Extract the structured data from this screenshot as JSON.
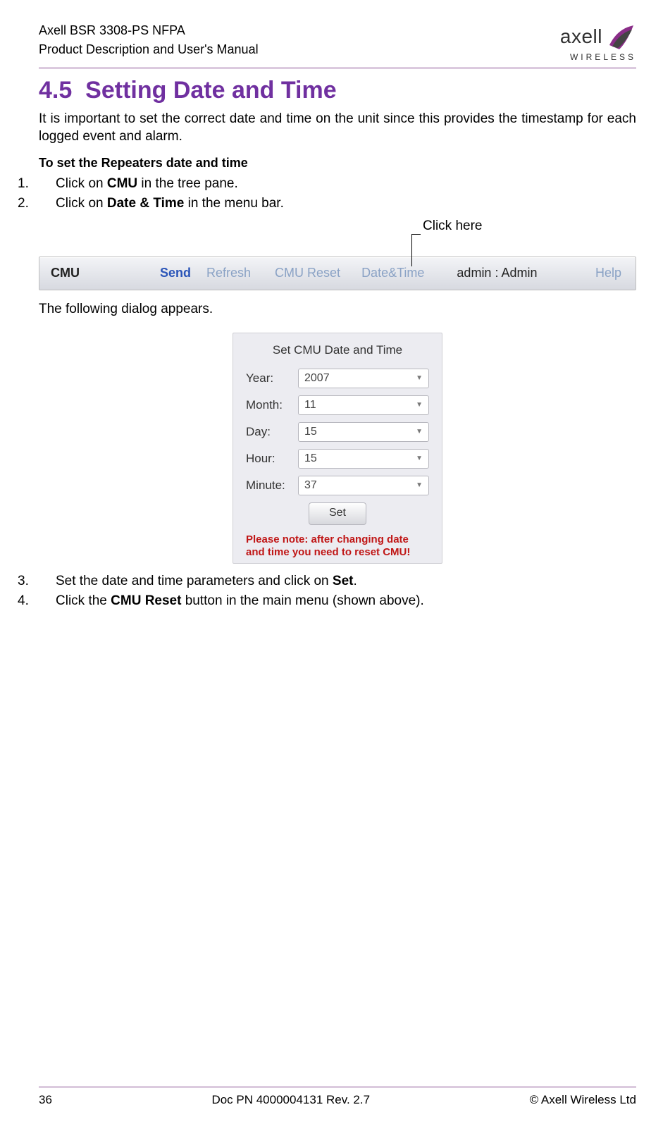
{
  "header": {
    "line1": "Axell BSR 3308-PS NFPA",
    "line2": "Product Description and User's Manual",
    "brand": "axell",
    "brand_sub": "WIRELESS"
  },
  "section": {
    "number": "4.5",
    "title": "Setting Date and Time"
  },
  "intro": "It is important to set the correct date and time on the unit since this provides the timestamp for each logged event and alarm.",
  "subhead": "To set the Repeaters date and time",
  "step1_pre": "Click on ",
  "step1_bold": "CMU",
  "step1_post": " in the tree pane.",
  "step2_pre": "Click on ",
  "step2_bold": "Date & Time",
  "step2_post": " in the menu bar.",
  "callout": "Click here",
  "menubar": {
    "cmu": "CMU",
    "send": "Send",
    "refresh": "Refresh",
    "reset": "CMU Reset",
    "datetime": "Date&Time",
    "admin": "admin : Admin",
    "help": "Help"
  },
  "following": "The following dialog appears.",
  "dialog": {
    "title": "Set CMU Date and Time",
    "rows": [
      {
        "label": "Year:",
        "value": "2007"
      },
      {
        "label": "Month:",
        "value": "11"
      },
      {
        "label": "Day:",
        "value": "15"
      },
      {
        "label": "Hour:",
        "value": "15"
      },
      {
        "label": "Minute:",
        "value": "37"
      }
    ],
    "set": "Set",
    "warn": "Please note: after changing date and time you need to reset CMU!"
  },
  "step3_pre": "Set the date and time parameters and click on ",
  "step3_bold": "Set",
  "step4_pre": "Click the ",
  "step4_bold": "CMU Reset",
  "step4_post": " button in the main menu (shown above).",
  "footer": {
    "page": "36",
    "mid": "Doc PN 4000004131 Rev. 2.7",
    "right": "© Axell Wireless Ltd"
  }
}
